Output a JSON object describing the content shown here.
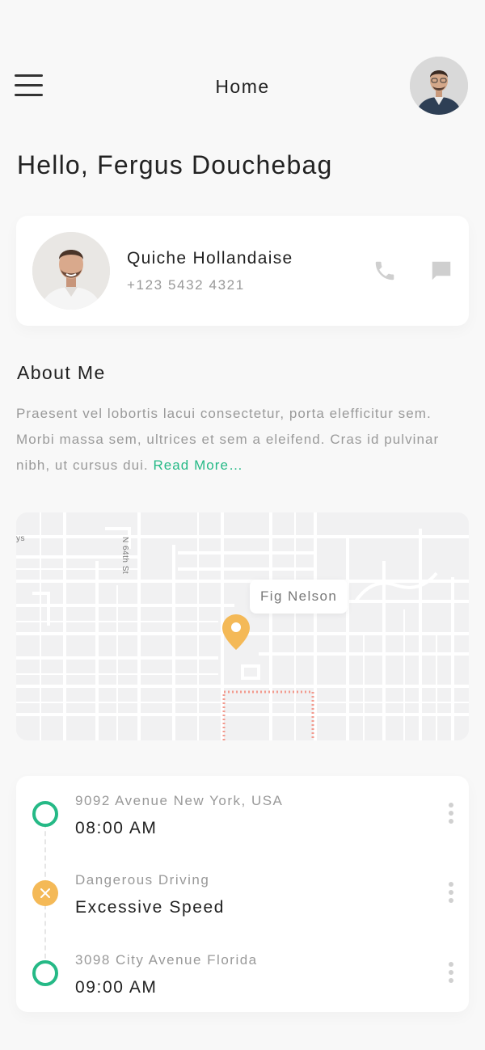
{
  "header": {
    "title": "Home",
    "menu_icon": "hamburger-menu-icon",
    "avatar_icon": "user-avatar"
  },
  "greeting": "Hello, Fergus Douchebag",
  "contact": {
    "name": "Quiche Hollandaise",
    "phone": "+123 5432 4321",
    "call_icon": "phone-icon",
    "message_icon": "message-icon"
  },
  "about": {
    "title": "About Me",
    "text": "Praesent vel lobortis lacui consectetur, porta elefficitur sem. Morbi massa sem, ultrices et sem a eleifend.  Cras id pulvinar nibh, ut cursus dui. ",
    "read_more": "Read More…"
  },
  "map": {
    "location_label": "Fig Nelson",
    "street_label": "N 64th St",
    "edge_label": "ys",
    "pin_color": "#f4b957",
    "route_color": "#f29a8e"
  },
  "timeline": [
    {
      "sub": "9092 Avenue New York, USA",
      "main": "08:00 AM",
      "status": "ok"
    },
    {
      "sub": "Dangerous Driving",
      "main": "Excessive Speed",
      "status": "warn"
    },
    {
      "sub": "3098 City Avenue Florida",
      "main": "09:00 AM",
      "status": "ok"
    }
  ],
  "colors": {
    "accent": "#25b986",
    "warning": "#f4b957",
    "background": "#f8f8f8"
  }
}
